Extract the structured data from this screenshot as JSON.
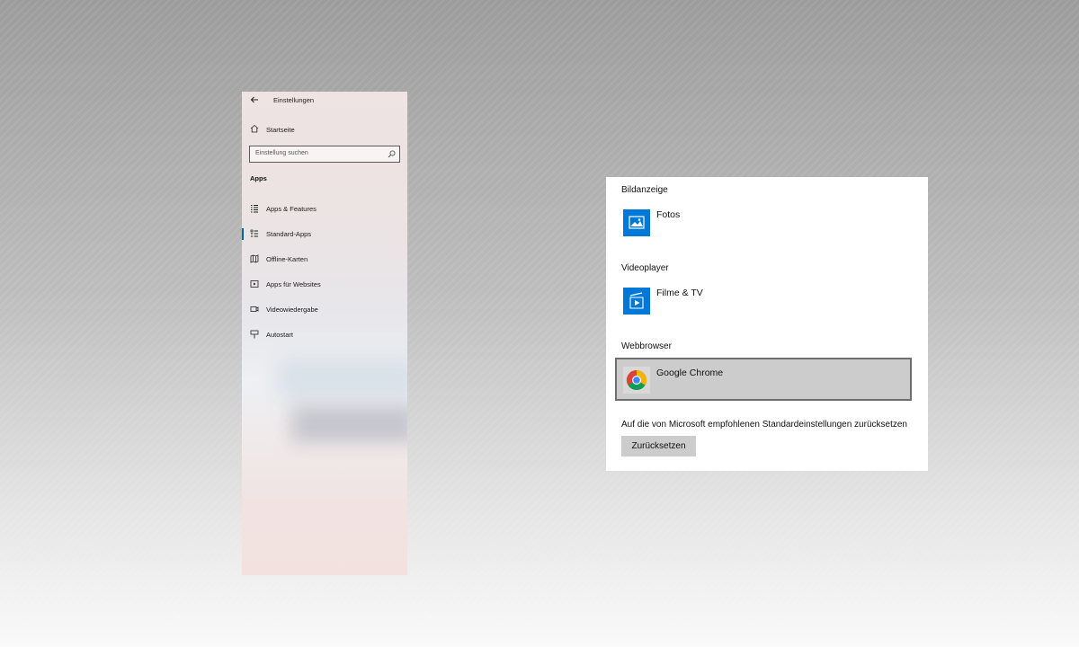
{
  "window": {
    "title": "Einstellungen",
    "back_icon": "arrow-left-icon"
  },
  "sidebar": {
    "home": {
      "label": "Startseite",
      "icon": "home-icon"
    },
    "search": {
      "placeholder": "Einstellung suchen",
      "icon": "search-icon"
    },
    "section_title": "Apps",
    "items": [
      {
        "label": "Apps & Features",
        "icon": "apps-features-icon",
        "selected": false
      },
      {
        "label": "Standard-Apps",
        "icon": "default-apps-icon",
        "selected": true
      },
      {
        "label": "Offline-Karten",
        "icon": "map-icon",
        "selected": false
      },
      {
        "label": "Apps für Websites",
        "icon": "apps-websites-icon",
        "selected": false
      },
      {
        "label": "Videowiedergabe",
        "icon": "video-icon",
        "selected": false
      },
      {
        "label": "Autostart",
        "icon": "startup-icon",
        "selected": false
      }
    ],
    "accent_color": "#0063b1"
  },
  "default_apps": {
    "categories": [
      {
        "label": "Bildanzeige",
        "app": "Fotos",
        "icon": "photos-icon"
      },
      {
        "label": "Videoplayer",
        "app": "Filme & TV",
        "icon": "movies-tv-icon"
      },
      {
        "label": "Webbrowser",
        "app": "Google Chrome",
        "icon": "chrome-icon",
        "selected": true
      }
    ],
    "reset_text": "Auf die von Microsoft empfohlenen Standardeinstellungen zurücksetzen",
    "reset_button": "Zurücksetzen",
    "tile_color": "#0078d7"
  }
}
